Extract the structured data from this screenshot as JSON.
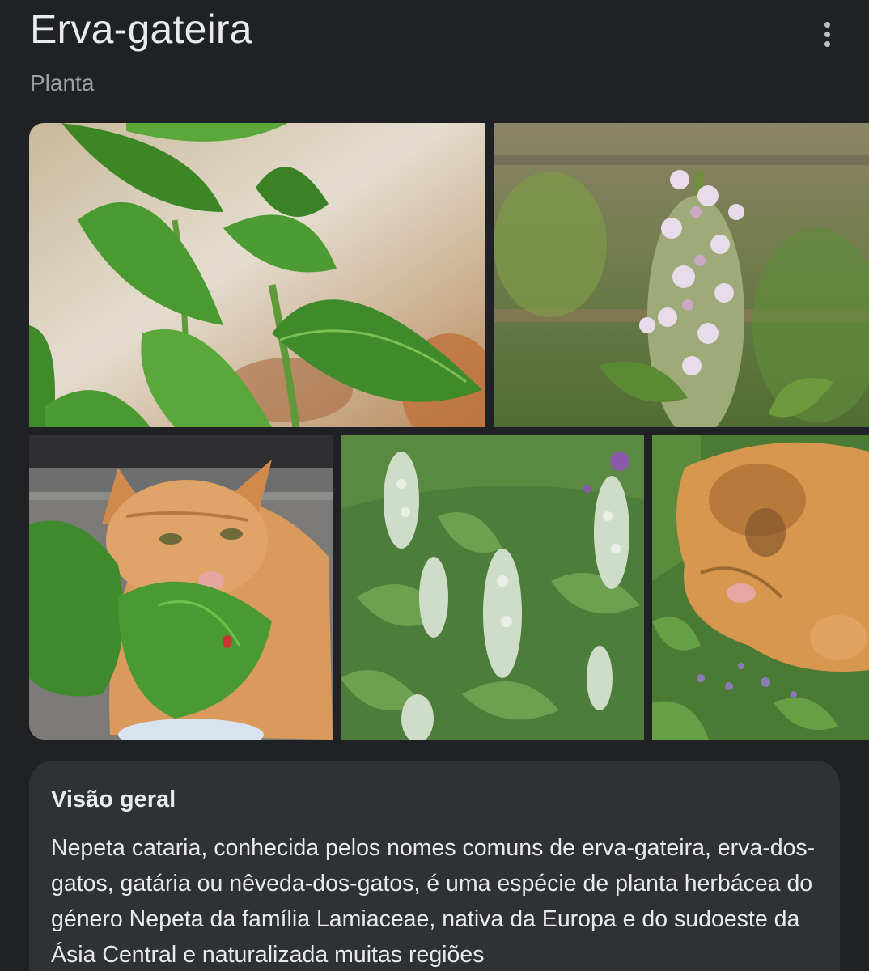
{
  "header": {
    "title": "Erva-gateira",
    "subtitle": "Planta"
  },
  "icons": {
    "more": "more-vert-icon"
  },
  "gallery": {
    "images": [
      {
        "subject": "catnip leaves close-up"
      },
      {
        "subject": "catnip flower spike"
      },
      {
        "subject": "orange cat sniffing catnip pot"
      },
      {
        "subject": "flowering catnip plants"
      },
      {
        "subject": "orange cat rolling in catnip"
      }
    ]
  },
  "overview": {
    "title": "Visão geral",
    "text": "Nepeta cataria, conhecida pelos nomes comuns de erva-gateira, erva-dos-gatos, gatária ou nêveda-dos-gatos, é uma espécie de planta herbácea do género Nepeta da família Lamiaceae, nativa da Europa e do sudoeste da Ásia Central e naturalizada muitas regiões"
  },
  "colors": {
    "background": "#202124",
    "card": "#303134",
    "text": "#e8eaed",
    "muted": "#9aa0a6"
  }
}
